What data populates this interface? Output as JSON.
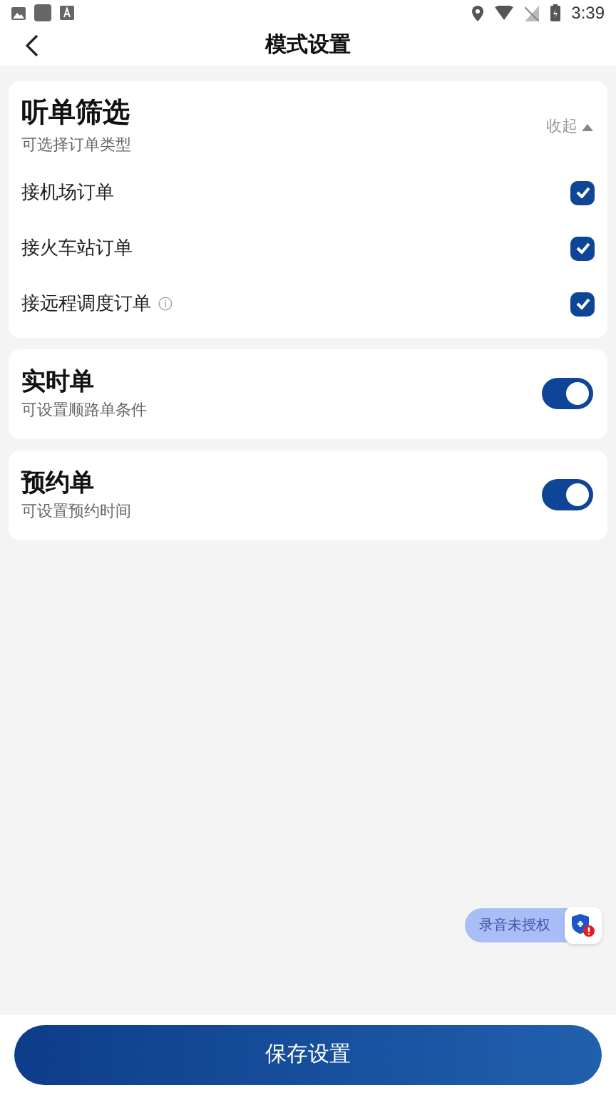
{
  "status_bar": {
    "time": "3:39"
  },
  "header": {
    "title": "模式设置"
  },
  "filter_card": {
    "title": "听单筛选",
    "subtitle": "可选择订单类型",
    "collapse_label": "收起",
    "expanded": true,
    "options": [
      {
        "label": "接机场订单",
        "kind": "plain",
        "checked": true
      },
      {
        "label": "接火车站订单",
        "kind": "plain",
        "checked": true
      },
      {
        "label": "接远程调度订单",
        "kind": "info",
        "checked": true
      }
    ]
  },
  "toggle_cards": [
    {
      "title": "实时单",
      "subtitle": "可设置顺路单条件",
      "on": true
    },
    {
      "title": "预约单",
      "subtitle": "可设置预约时间",
      "on": true
    }
  ],
  "permission_badge": {
    "label": "录音未授权"
  },
  "save_button": {
    "label": "保存设置"
  }
}
